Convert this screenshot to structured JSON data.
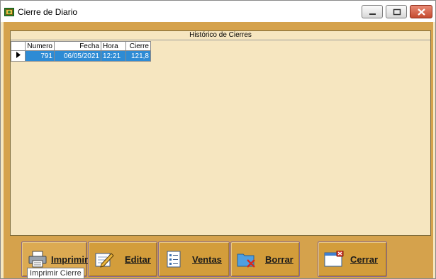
{
  "window": {
    "title": "Cierre de Diario"
  },
  "grid": {
    "caption": "Histórico de Cierres",
    "columns": [
      "Numero",
      "Fecha",
      "Hora",
      "Cierre"
    ],
    "rows": [
      {
        "numero": "791",
        "fecha": "06/05/2021",
        "hora": "12:21",
        "cierre": "121,8"
      }
    ]
  },
  "buttons": {
    "imprimir": "Imprimir",
    "editar": "Editar",
    "ventas": "Ventas",
    "borrar": "Borrar",
    "cerrar": "Cerrar"
  },
  "tooltip": {
    "text": "Imprimir Cierre"
  },
  "colors": {
    "frame": "#d5a24c",
    "grid_background": "#f6e6c0",
    "selection": "#2e8bd4",
    "button": "#d39d3b"
  }
}
